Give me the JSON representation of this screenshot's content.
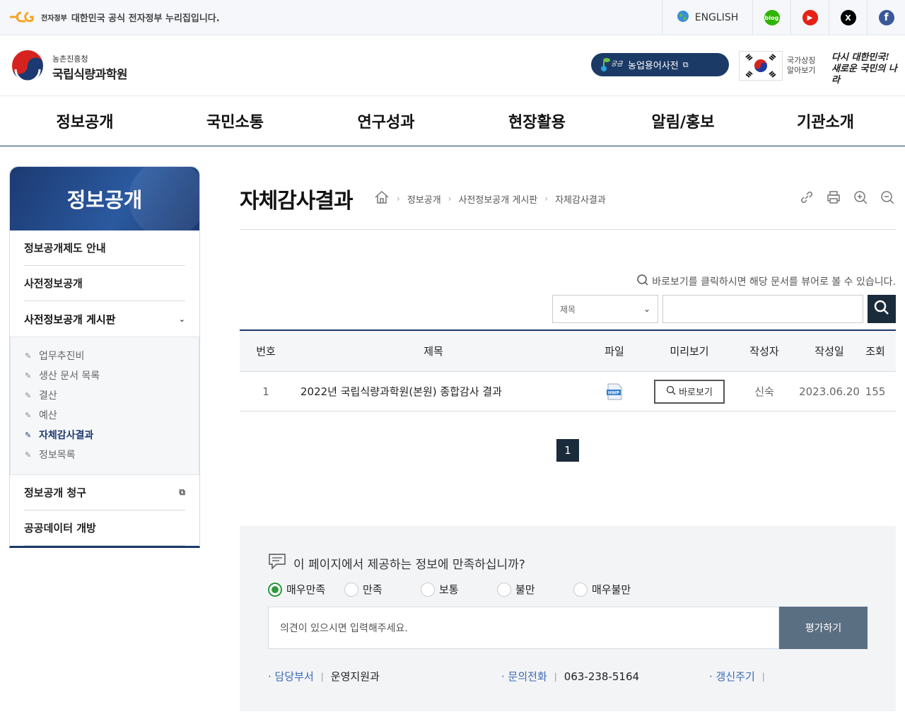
{
  "topbar": {
    "gov_tag": "전자정부",
    "gov_text": "대한민국 공식 전자정부 누리집입니다.",
    "english_label": "ENGLISH",
    "sns": [
      {
        "name": "blog",
        "glyph": "blog",
        "color": "#2db400"
      },
      {
        "name": "youtube",
        "glyph": "▶",
        "color": "#e62117"
      },
      {
        "name": "x",
        "glyph": "𝕏",
        "color": "#000000"
      },
      {
        "name": "facebook",
        "glyph": "f",
        "color": "#3b5998"
      }
    ]
  },
  "header": {
    "org_parent": "농촌진흥청",
    "org_name": "국립식량과학원",
    "dict_label": "농업용어사전",
    "flag_text_1": "국가상징",
    "flag_text_2": "알아보기",
    "slogan_1": "다시 대한민국!",
    "slogan_2": "새로운 국민의 나라"
  },
  "gnb": [
    "정보공개",
    "국민소통",
    "연구성과",
    "현장활용",
    "알림/홍보",
    "기관소개"
  ],
  "lnb": {
    "title": "정보공개",
    "items": [
      "정보공개제도 안내",
      "사전정보공개",
      "사전정보공개 게시판",
      "정보공개 청구",
      "공공데이터 개방"
    ],
    "sub_items": [
      "업무추진비",
      "생산 문서 목록",
      "결산",
      "예산",
      "자체감사결과",
      "정보목록"
    ],
    "active_sub": "자체감사결과"
  },
  "page": {
    "title": "자체감사결과",
    "breadcrumb": [
      "정보공개",
      "사전정보공개 게시판",
      "자체감사결과"
    ],
    "notice": "바로보기를 클릭하시면 해당 문서를 뷰어로 볼 수 있습니다.",
    "search_select": "제목",
    "search_input": ""
  },
  "table": {
    "headers": [
      "번호",
      "제목",
      "파일",
      "미리보기",
      "작성자",
      "작성일",
      "조회"
    ],
    "rows": [
      {
        "no": "1",
        "title": "2022년 국립식량과학원(본원) 종합감사 결과",
        "file": "HWP",
        "preview": "바로보기",
        "author": "신숙",
        "date": "2023.06.20",
        "views": "155"
      }
    ]
  },
  "pagination": {
    "current": "1"
  },
  "survey": {
    "question": "이 페이지에서 제공하는 정보에 만족하십니까?",
    "options": [
      "매우만족",
      "만족",
      "보통",
      "불만",
      "매우불만"
    ],
    "selected": "매우만족",
    "placeholder": "의견이 있으시면 입력해주세요.",
    "submit": "평가하기",
    "dept_label": "담당부서",
    "dept_value": "운영지원과",
    "phone_label": "문의전화",
    "phone_value": "063-238-5164",
    "cycle_label": "갱신주기",
    "cycle_value": ""
  },
  "colors": {
    "brand": "#1c3a66",
    "accent": "#2e9b3e",
    "link": "#3b69b5"
  }
}
